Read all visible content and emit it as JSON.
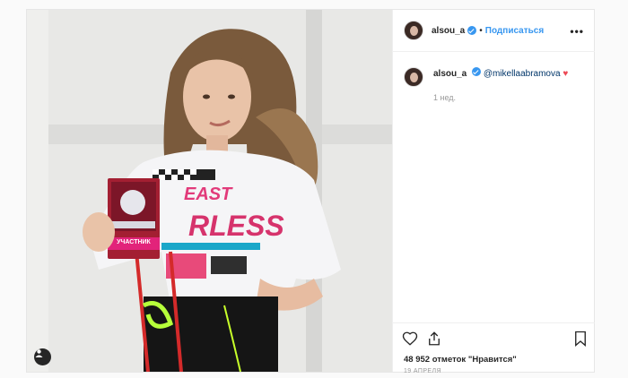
{
  "post": {
    "username": "alsou_a",
    "separator": "•",
    "follow_label": "Подписаться",
    "more_label": "•••",
    "caption": {
      "username": "alsou_a",
      "mention": "@mikellaabramova",
      "emoji": "♥",
      "time": "1 нед."
    },
    "likes_text": "48 952 отметок \"Нравится\"",
    "date_text": "19 АПРЕЛЯ",
    "badge_text": "УЧАСТНИК",
    "icons": [
      "heart-icon",
      "share-icon",
      "bookmark-icon",
      "tag-user-icon",
      "verified-badge-icon",
      "more-options-icon"
    ],
    "colors": {
      "accent": "#3897f0",
      "mention": "#003569",
      "heart": "#ed4956"
    }
  }
}
